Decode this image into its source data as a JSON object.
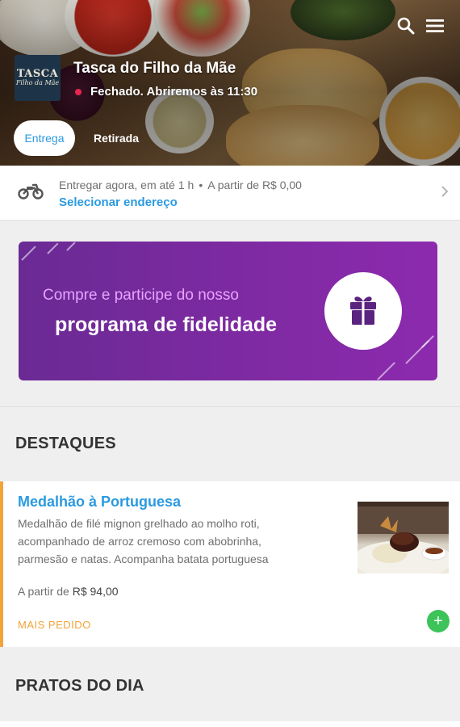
{
  "header": {
    "search_icon": "search-icon",
    "menu_icon": "menu-icon",
    "logo_text_top": "TASCA",
    "logo_text_bottom": "Filho da Mãe",
    "restaurant_name": "Tasca do Filho da Mãe",
    "status_text": "Fechado. Abriremos às 11:30",
    "status_color": "#e8264f",
    "tabs": [
      {
        "label": "Entrega",
        "active": true
      },
      {
        "label": "Retirada",
        "active": false
      }
    ]
  },
  "delivery": {
    "icon": "motorcycle-icon",
    "info_time": "Entregar agora, em até 1 h",
    "info_separator": "•",
    "info_min": "A partir de R$ 0,00",
    "select_address": "Selecionar endereço"
  },
  "banner": {
    "line1": "Compre e participe do nosso",
    "line2": "programa de fidelidade",
    "icon": "gift-icon"
  },
  "sections": {
    "highlights_title": "DESTAQUES",
    "daily_title": "PRATOS DO DIA"
  },
  "product": {
    "name": "Medalhão à Portuguesa",
    "description_lines": [
      "Medalhão de filé mignon grelhado ao molho roti,",
      "acompanhado de arroz cremoso com abobrinha,",
      "parmesão e natas. Acompanha batata portuguesa"
    ],
    "price_prefix": "A partir de",
    "price": "R$ 94,00",
    "badge": "MAIS PEDIDO",
    "add_label": "+"
  },
  "colors": {
    "accent_blue": "#2b9ae0",
    "badge_orange": "#f2a33a",
    "add_green": "#3cc35a",
    "banner_purple": "#7e2aa2"
  }
}
